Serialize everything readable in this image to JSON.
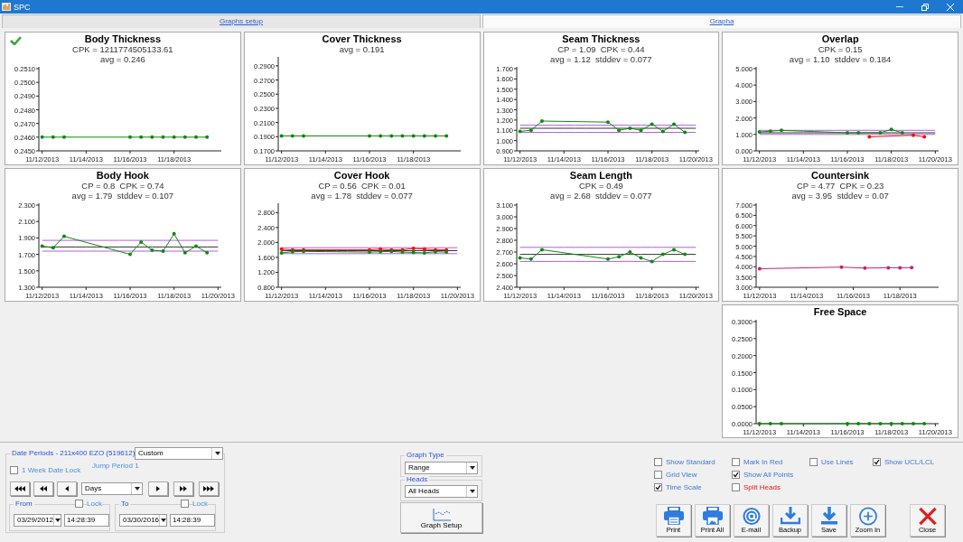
{
  "window": {
    "title": "SPC"
  },
  "tabs": [
    {
      "label": "Graphs setup",
      "selected": false
    },
    {
      "label": "Grapha",
      "selected": true
    }
  ],
  "charts": [
    {
      "title": "Body Thickness",
      "ok": true,
      "stats": [
        "CPK = 1211774505133.61",
        "avg = 0.246"
      ],
      "chart_data": {
        "type": "line",
        "categories": [
          "11/12/2013",
          null,
          null,
          null,
          "11/14/2013",
          null,
          null,
          null,
          "11/16/2013",
          null,
          null,
          null,
          "11/18/2013",
          null,
          null,
          null,
          null
        ],
        "ylim": [
          0.245,
          0.251
        ],
        "yticks": [
          {
            "value": 0.245,
            "label": "0.2450"
          },
          {
            "value": 0.246,
            "label": "0.2460"
          },
          {
            "value": 0.247,
            "label": "0.2470"
          },
          {
            "value": 0.248,
            "label": "0.2480"
          },
          {
            "value": 0.249,
            "label": "0.2490"
          },
          {
            "value": 0.25,
            "label": "0.2500"
          },
          {
            "value": 0.251,
            "label": "0.2510"
          }
        ],
        "series": [
          {
            "color": "#118811",
            "values": [
              0.246,
              0.246,
              0.246,
              null,
              null,
              null,
              null,
              null,
              0.246,
              0.246,
              0.246,
              0.246,
              0.246,
              0.246,
              0.246,
              0.246,
              null
            ]
          }
        ]
      }
    },
    {
      "title": "Cover Thickness",
      "ok": false,
      "stats": [
        "avg = 0.191"
      ],
      "chart_data": {
        "type": "line",
        "categories": [
          "11/12/2013",
          null,
          null,
          null,
          "11/14/2013",
          null,
          null,
          null,
          "11/16/2013",
          null,
          null,
          null,
          "11/18/2013",
          null,
          null,
          null,
          null
        ],
        "ylim": [
          0.17,
          0.3
        ],
        "yticks": [
          {
            "value": 0.17,
            "label": "0.1700"
          },
          {
            "value": 0.19,
            "label": "0.1900"
          },
          {
            "value": 0.21,
            "label": "0.2100"
          },
          {
            "value": 0.23,
            "label": "0.2300"
          },
          {
            "value": 0.25,
            "label": "0.2500"
          },
          {
            "value": 0.27,
            "label": "0.2700"
          },
          {
            "value": 0.29,
            "label": "0.2900"
          }
        ],
        "series": [
          {
            "color": "#118811",
            "values": [
              0.191,
              0.191,
              0.191,
              null,
              null,
              null,
              null,
              null,
              0.191,
              0.191,
              0.191,
              0.191,
              0.191,
              0.191,
              0.191,
              0.191,
              null
            ]
          }
        ]
      }
    },
    {
      "title": "Seam Thickness",
      "ok": false,
      "stats": [
        "CP = 1.09  CPK = 0.44",
        "avg = 1.12  stddev = 0.077"
      ],
      "chart_data": {
        "type": "line",
        "categories": [
          "11/12/2013",
          null,
          null,
          null,
          "11/14/2013",
          null,
          null,
          null,
          "11/16/2013",
          null,
          null,
          null,
          "11/18/2013",
          null,
          null,
          null,
          "11/20/2013"
        ],
        "ylim": [
          0.9,
          1.7
        ],
        "yticks": [
          {
            "value": 0.9,
            "label": "0.900"
          },
          {
            "value": 1.0,
            "label": "1.000"
          },
          {
            "value": 1.1,
            "label": "1.100"
          },
          {
            "value": 1.2,
            "label": "1.200"
          },
          {
            "value": 1.3,
            "label": "1.300"
          },
          {
            "value": 1.4,
            "label": "1.400"
          },
          {
            "value": 1.5,
            "label": "1.500"
          },
          {
            "value": 1.6,
            "label": "1.600"
          },
          {
            "value": 1.7,
            "label": "1.700"
          }
        ],
        "series": [
          {
            "color": "#118811",
            "values": [
              1.09,
              1.1,
              1.19,
              null,
              null,
              null,
              null,
              null,
              1.18,
              1.1,
              1.12,
              1.1,
              1.16,
              1.09,
              1.16,
              1.08,
              null
            ]
          },
          {
            "color": "#b060e0",
            "values": [
              1.15,
              1.15,
              1.15,
              1.15,
              1.15,
              1.15,
              1.15,
              1.15,
              1.15,
              1.15,
              1.15,
              1.15,
              1.15,
              1.15,
              1.15,
              1.15,
              1.15
            ]
          },
          {
            "color": "#333333",
            "values": [
              1.12,
              1.12,
              1.12,
              1.12,
              1.12,
              1.12,
              1.12,
              1.12,
              1.12,
              1.12,
              1.12,
              1.12,
              1.12,
              1.12,
              1.12,
              1.12,
              1.12
            ]
          },
          {
            "color": "#b060e0",
            "values": [
              1.08,
              1.08,
              1.08,
              1.08,
              1.08,
              1.08,
              1.08,
              1.08,
              1.08,
              1.08,
              1.08,
              1.08,
              1.08,
              1.08,
              1.08,
              1.08,
              1.08
            ]
          }
        ]
      }
    },
    {
      "title": "Overlap",
      "ok": false,
      "stats": [
        "CPK = 0.15",
        "avg = 1.10  stddev = 0.184"
      ],
      "chart_data": {
        "type": "line",
        "categories": [
          "11/12/2013",
          null,
          null,
          null,
          "11/14/2013",
          null,
          null,
          null,
          "11/16/2013",
          null,
          null,
          null,
          "11/18/2013",
          null,
          null,
          null,
          "11/20/2013"
        ],
        "ylim": [
          0,
          5
        ],
        "yticks": [
          {
            "value": 0,
            "label": "0.000"
          },
          {
            "value": 1,
            "label": "1.000"
          },
          {
            "value": 2,
            "label": "2.000"
          },
          {
            "value": 3,
            "label": "3.000"
          },
          {
            "value": 4,
            "label": "4.000"
          },
          {
            "value": 5,
            "label": "5.000"
          }
        ],
        "series": [
          {
            "color": "#118811",
            "values": [
              1.15,
              1.2,
              1.25,
              null,
              null,
              null,
              null,
              null,
              1.1,
              1.1,
              null,
              1.1,
              1.3,
              1.1,
              null,
              null,
              null
            ]
          },
          {
            "color": "#ee1111",
            "values": [
              null,
              null,
              null,
              null,
              null,
              null,
              null,
              null,
              null,
              null,
              0.85,
              null,
              null,
              null,
              0.95,
              0.85,
              null
            ]
          },
          {
            "color": "#b060e0",
            "values": [
              1.25,
              1.25,
              1.25,
              1.25,
              1.25,
              1.25,
              1.25,
              1.25,
              1.25,
              1.25,
              1.25,
              1.25,
              1.25,
              1.25,
              1.25,
              1.25,
              1.25
            ]
          },
          {
            "color": "#333333",
            "values": [
              1.1,
              1.1,
              1.1,
              1.1,
              1.1,
              1.1,
              1.1,
              1.1,
              1.1,
              1.1,
              1.1,
              1.1,
              1.1,
              1.1,
              1.1,
              1.1,
              1.1
            ]
          },
          {
            "color": "#b060e0",
            "values": [
              1.0,
              1.0,
              1.0,
              1.0,
              1.0,
              1.0,
              1.0,
              1.0,
              1.0,
              1.0,
              1.0,
              1.0,
              1.0,
              1.0,
              1.0,
              1.0,
              1.0
            ]
          }
        ]
      }
    },
    {
      "title": "Body Hook",
      "ok": false,
      "stats": [
        "CP = 0.8  CPK = 0.74",
        "avg = 1.79  stddev = 0.107"
      ],
      "chart_data": {
        "type": "line",
        "categories": [
          "11/12/2013",
          null,
          null,
          null,
          "11/14/2013",
          null,
          null,
          null,
          "11/16/2013",
          null,
          null,
          null,
          "11/18/2013",
          null,
          null,
          null,
          "11/20/2013"
        ],
        "ylim": [
          1.3,
          2.3
        ],
        "yticks": [
          {
            "value": 1.3,
            "label": "1.300"
          },
          {
            "value": 1.5,
            "label": "1.500"
          },
          {
            "value": 1.7,
            "label": "1.700"
          },
          {
            "value": 1.9,
            "label": "1.900"
          },
          {
            "value": 2.1,
            "label": "2.100"
          },
          {
            "value": 2.3,
            "label": "2.300"
          }
        ],
        "series": [
          {
            "color": "#118811",
            "values": [
              1.8,
              1.78,
              1.92,
              null,
              null,
              null,
              null,
              null,
              1.7,
              1.85,
              1.75,
              1.74,
              1.95,
              1.72,
              1.8,
              1.72,
              null
            ]
          },
          {
            "color": "#b060e0",
            "values": [
              1.87,
              1.87,
              1.87,
              1.87,
              1.87,
              1.87,
              1.87,
              1.87,
              1.87,
              1.87,
              1.87,
              1.87,
              1.87,
              1.87,
              1.87,
              1.87,
              1.87
            ]
          },
          {
            "color": "#333333",
            "values": [
              1.79,
              1.79,
              1.79,
              1.79,
              1.79,
              1.79,
              1.79,
              1.79,
              1.79,
              1.79,
              1.79,
              1.79,
              1.79,
              1.79,
              1.79,
              1.79,
              1.79
            ]
          },
          {
            "color": "#b060e0",
            "values": [
              1.74,
              1.74,
              1.74,
              1.74,
              1.74,
              1.74,
              1.74,
              1.74,
              1.74,
              1.74,
              1.74,
              1.74,
              1.74,
              1.74,
              1.74,
              1.74,
              1.74
            ]
          }
        ]
      }
    },
    {
      "title": "Cover Hook",
      "ok": false,
      "stats": [
        "CP = 0.56  CPK = 0.01",
        "avg = 1.78  stddev = 0.077"
      ],
      "chart_data": {
        "type": "line",
        "categories": [
          "11/12/2013",
          null,
          null,
          null,
          "11/14/2013",
          null,
          null,
          null,
          "11/16/2013",
          null,
          null,
          null,
          "11/18/2013",
          null,
          null,
          null,
          "11/20/2013"
        ],
        "ylim": [
          0.8,
          3.0
        ],
        "yticks": [
          {
            "value": 0.8,
            "label": "0.800"
          },
          {
            "value": 1.2,
            "label": "1.200"
          },
          {
            "value": 1.6,
            "label": "1.600"
          },
          {
            "value": 2.0,
            "label": "2.000"
          },
          {
            "value": 2.4,
            "label": "2.400"
          },
          {
            "value": 2.8,
            "label": "2.800"
          }
        ],
        "series": [
          {
            "color": "#118811",
            "values": [
              1.72,
              1.75,
              1.76,
              null,
              null,
              null,
              null,
              null,
              1.74,
              1.75,
              1.76,
              1.74,
              1.73,
              1.72,
              1.75,
              1.74,
              null
            ]
          },
          {
            "color": "#ee1111",
            "values": [
              1.82,
              1.8,
              1.8,
              null,
              null,
              null,
              null,
              null,
              1.8,
              1.82,
              1.8,
              1.8,
              1.84,
              1.82,
              1.8,
              1.8,
              null
            ]
          },
          {
            "color": "#b060e0",
            "values": [
              1.86,
              1.86,
              1.86,
              1.86,
              1.86,
              1.86,
              1.86,
              1.86,
              1.86,
              1.86,
              1.86,
              1.86,
              1.86,
              1.86,
              1.86,
              1.86,
              1.86
            ]
          },
          {
            "color": "#333333",
            "values": [
              1.78,
              1.78,
              1.78,
              1.78,
              1.78,
              1.78,
              1.78,
              1.78,
              1.78,
              1.78,
              1.78,
              1.78,
              1.78,
              1.78,
              1.78,
              1.78,
              1.78
            ]
          },
          {
            "color": "#b060e0",
            "values": [
              1.7,
              1.7,
              1.7,
              1.7,
              1.7,
              1.7,
              1.7,
              1.7,
              1.7,
              1.7,
              1.7,
              1.7,
              1.7,
              1.7,
              1.7,
              1.7,
              1.7
            ]
          }
        ]
      }
    },
    {
      "title": "Seam Length",
      "ok": false,
      "stats": [
        "CPK = 0.49",
        "avg = 2.68  stddev = 0.077"
      ],
      "chart_data": {
        "type": "line",
        "categories": [
          "11/12/2013",
          null,
          null,
          null,
          "11/14/2013",
          null,
          null,
          null,
          "11/16/2013",
          null,
          null,
          null,
          "11/18/2013",
          null,
          null,
          null,
          "11/20/2013"
        ],
        "ylim": [
          2.4,
          3.1
        ],
        "yticks": [
          {
            "value": 2.4,
            "label": "2.400"
          },
          {
            "value": 2.5,
            "label": "2.500"
          },
          {
            "value": 2.6,
            "label": "2.600"
          },
          {
            "value": 2.7,
            "label": "2.700"
          },
          {
            "value": 2.8,
            "label": "2.800"
          },
          {
            "value": 2.9,
            "label": "2.900"
          },
          {
            "value": 3.0,
            "label": "3.000"
          },
          {
            "value": 3.1,
            "label": "3.100"
          }
        ],
        "series": [
          {
            "color": "#118811",
            "values": [
              2.65,
              2.64,
              2.72,
              null,
              null,
              null,
              null,
              null,
              2.64,
              2.66,
              2.7,
              2.65,
              2.62,
              2.68,
              2.72,
              2.68,
              null
            ]
          },
          {
            "color": "#b060e0",
            "values": [
              2.74,
              2.74,
              2.74,
              2.74,
              2.74,
              2.74,
              2.74,
              2.74,
              2.74,
              2.74,
              2.74,
              2.74,
              2.74,
              2.74,
              2.74,
              2.74,
              2.74
            ]
          },
          {
            "color": "#333333",
            "values": [
              2.68,
              2.68,
              2.68,
              2.68,
              2.68,
              2.68,
              2.68,
              2.68,
              2.68,
              2.68,
              2.68,
              2.68,
              2.68,
              2.68,
              2.68,
              2.68,
              2.68
            ]
          },
          {
            "color": "#b060e0",
            "values": [
              2.62,
              2.62,
              2.62,
              2.62,
              2.62,
              2.62,
              2.62,
              2.62,
              2.62,
              2.62,
              2.62,
              2.62,
              2.62,
              2.62,
              2.62,
              2.62,
              2.62
            ]
          }
        ]
      }
    },
    {
      "title": "Countersink",
      "ok": false,
      "stats": [
        "CP = 4.77  CPK = 0.23",
        "avg = 3.95  stddev = 0.07"
      ],
      "chart_data": {
        "type": "line",
        "categories": [
          "11/12/2013",
          null,
          null,
          null,
          "11/14/2013",
          null,
          null,
          null,
          "11/16/2013",
          null,
          null,
          null,
          "11/18/2013",
          null,
          null,
          null
        ],
        "ylim": [
          3.0,
          7.0
        ],
        "yticks": [
          {
            "value": 3.0,
            "label": "3.000"
          },
          {
            "value": 3.5,
            "label": "3.500"
          },
          {
            "value": 4.0,
            "label": "4.000"
          },
          {
            "value": 4.5,
            "label": "4.500"
          },
          {
            "value": 5.0,
            "label": "5.000"
          },
          {
            "value": 5.5,
            "label": "5.500"
          },
          {
            "value": 6.0,
            "label": "6.000"
          },
          {
            "value": 6.5,
            "label": "6.500"
          },
          {
            "value": 7.0,
            "label": "7.000"
          }
        ],
        "series": [
          {
            "color": "#c02080",
            "values": [
              3.9,
              null,
              null,
              null,
              null,
              null,
              null,
              3.98,
              null,
              3.93,
              null,
              3.95,
              3.95,
              3.96,
              null,
              null
            ]
          }
        ]
      }
    },
    {
      "title": "Free Space",
      "ok": false,
      "chart_data": {
        "type": "line",
        "categories": [
          "11/12/2013",
          null,
          null,
          null,
          "11/14/2013",
          null,
          null,
          null,
          "11/16/2013",
          null,
          null,
          null,
          "11/18/2013",
          null,
          null,
          null,
          "11/20/2013"
        ],
        "ylim": [
          0,
          0.3
        ],
        "yticks": [
          {
            "value": 0,
            "label": "0.0000"
          },
          {
            "value": 0.05,
            "label": "0.0500"
          },
          {
            "value": 0.1,
            "label": "0.1000"
          },
          {
            "value": 0.15,
            "label": "0.1500"
          },
          {
            "value": 0.2,
            "label": "0.2000"
          },
          {
            "value": 0.25,
            "label": "0.2500"
          },
          {
            "value": 0.3,
            "label": "0.3000"
          }
        ],
        "series": [
          {
            "color": "#118811",
            "values": [
              0,
              0,
              0,
              null,
              null,
              null,
              null,
              null,
              0,
              0,
              0,
              0,
              0,
              0,
              0,
              0,
              null
            ]
          }
        ]
      }
    }
  ],
  "date_periods": {
    "title": "Date Periods - 211x400 EZO (519612)",
    "period": "Custom",
    "jump_label": "Jump Period 1",
    "week_lock": {
      "label": "1 Week Date Lock",
      "checked": false
    },
    "nav_left": [
      {
        "kind": "first"
      },
      {
        "kind": "back_page"
      },
      {
        "kind": "back"
      }
    ],
    "unit": "Days",
    "nav_right": [
      {
        "kind": "forward"
      },
      {
        "kind": "forward_page"
      },
      {
        "kind": "last"
      }
    ],
    "ranges": [
      {
        "legend": "From",
        "lock": {
          "label": "Lock",
          "checked": false
        },
        "date": "03/29/2012",
        "time": "14:28:39"
      },
      {
        "legend": "To",
        "lock": {
          "label": "Lock",
          "checked": false
        },
        "date": "03/30/2016",
        "time": "14:28:39"
      }
    ]
  },
  "graph_type": {
    "legend": "Graph Type",
    "value": "Range"
  },
  "heads": {
    "legend": "Heads",
    "value": "All Heads"
  },
  "graph_setup": {
    "label": "Graph Setup"
  },
  "options": [
    [
      {
        "label": "Show Standard",
        "checked": false,
        "alert": false
      },
      {
        "label": "Mark In Red",
        "checked": false,
        "alert": false
      },
      {
        "label": "Use Lines",
        "checked": false,
        "alert": false
      },
      {
        "label": "Show UCL/LCL",
        "checked": true,
        "alert": false
      }
    ],
    [
      {
        "label": "Grid View",
        "checked": false,
        "alert": false
      },
      {
        "label": "Show All Points",
        "checked": true,
        "alert": false
      }
    ],
    [
      {
        "label": "Time Scale",
        "checked": true,
        "alert": false
      },
      {
        "label": "Split Heads",
        "checked": false,
        "alert": true
      }
    ]
  ],
  "actions": [
    {
      "kind": "print",
      "label": "Print"
    },
    {
      "kind": "print_all",
      "label": "Print All"
    },
    {
      "kind": "email",
      "label": "E-mail"
    },
    {
      "kind": "backup",
      "label": "Backup"
    },
    {
      "kind": "save",
      "label": "Save"
    },
    {
      "kind": "zoom_in",
      "label": "Zoom In"
    }
  ],
  "close": {
    "kind": "close",
    "label": "Close"
  }
}
